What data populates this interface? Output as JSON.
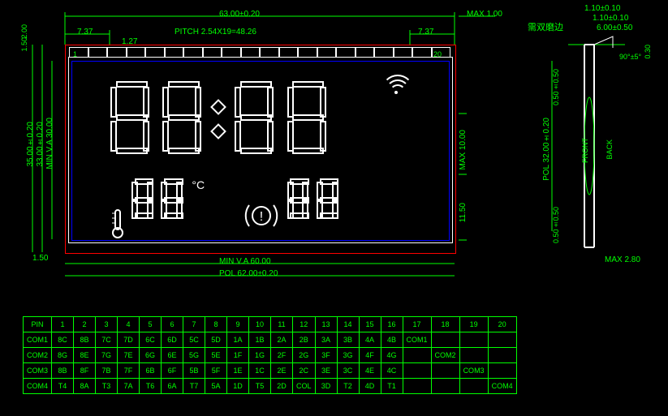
{
  "dims": {
    "top_width": "63.00±0.20",
    "top_left_gap": "7.37",
    "top_right_gap": "7.37",
    "pitch": "PITCH 2.54X19=48.26",
    "pin_pitch": "1.27",
    "left_top_v1": "2.00",
    "left_top_v2": "1.50",
    "left_h1": "35.00±0.20",
    "left_h2": "33.00±0.20",
    "left_h3": "MIN V.A 30.00",
    "left_bot": "1.50",
    "bot_va": "MIN V.A 60.00",
    "bot_pol": "POL 62.00±0.20",
    "right_max1": "MAX 1.00",
    "right_max10": "MAX 10.00",
    "right_1150": "11.50",
    "side_110a": "1.10±0.10",
    "side_110b": "1.10±0.10",
    "side_600": "6.00±0.50",
    "side_030": "0.30",
    "side_90": "90°±5°",
    "side_pol": "POL 32.00±0.20",
    "side_050a": "0.50±0.50",
    "side_050b": "0.50±0.50",
    "side_front": "FRONT",
    "side_back": "BACK",
    "side_max280": "MAX 2.80",
    "chinese_label": "需双磨边"
  },
  "pins": {
    "first": "1",
    "last": "20"
  },
  "table": {
    "headers": [
      "PIN",
      "1",
      "2",
      "3",
      "4",
      "5",
      "6",
      "7",
      "8",
      "9",
      "10",
      "11",
      "12",
      "13",
      "14",
      "15",
      "16",
      "17",
      "18",
      "19",
      "20"
    ],
    "rows": [
      [
        "COM1",
        "8C",
        "8B",
        "7C",
        "7D",
        "6C",
        "6D",
        "5C",
        "5D",
        "1A",
        "1B",
        "2A",
        "2B",
        "3A",
        "3B",
        "4A",
        "4B",
        "COM1",
        "",
        "",
        ""
      ],
      [
        "COM2",
        "8G",
        "8E",
        "7G",
        "7E",
        "6G",
        "6E",
        "5G",
        "5E",
        "1F",
        "1G",
        "2F",
        "2G",
        "3F",
        "3G",
        "4F",
        "4G",
        "",
        "COM2",
        "",
        ""
      ],
      [
        "COM3",
        "8B",
        "8F",
        "7B",
        "7F",
        "6B",
        "6F",
        "5B",
        "5F",
        "1E",
        "1C",
        "2E",
        "2C",
        "3E",
        "3C",
        "4E",
        "4C",
        "",
        "",
        "COM3",
        ""
      ],
      [
        "COM4",
        "T4",
        "8A",
        "T3",
        "7A",
        "T6",
        "6A",
        "T7",
        "5A",
        "1D",
        "T5",
        "2D",
        "COL",
        "3D",
        "T2",
        "4D",
        "T1",
        "",
        "",
        "",
        "COM4"
      ]
    ]
  },
  "display": {
    "degree": "°C"
  }
}
